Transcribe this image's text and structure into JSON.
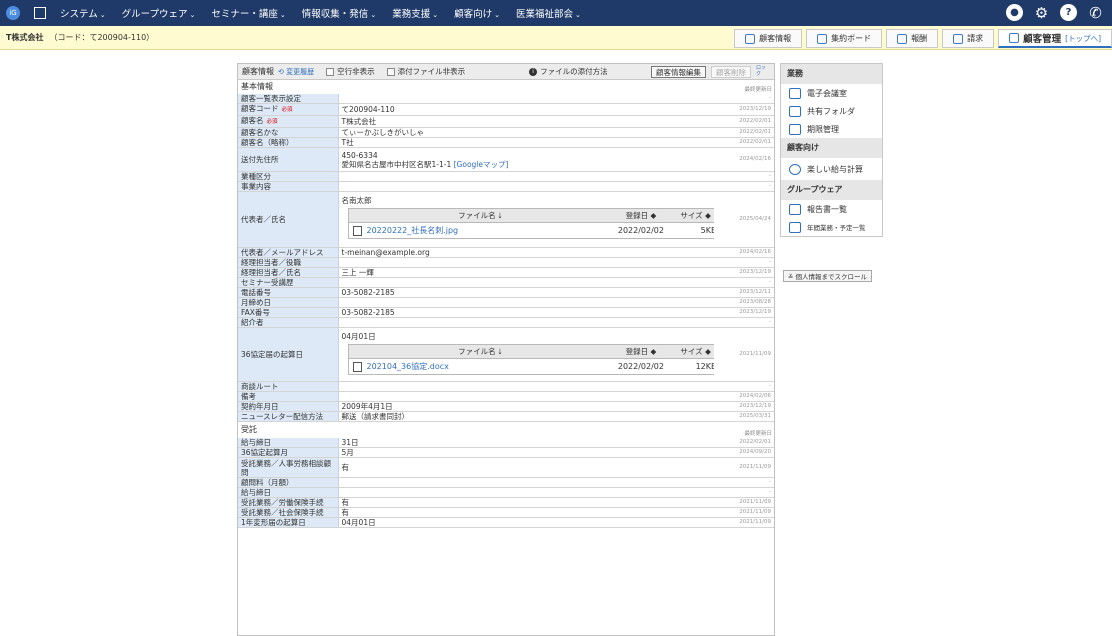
{
  "nav": {
    "items": [
      {
        "label": "システム"
      },
      {
        "label": "グループウェア"
      },
      {
        "label": "セミナー・講座"
      },
      {
        "label": "情報収集・発信"
      },
      {
        "label": "業務支援"
      },
      {
        "label": "顧客向け"
      },
      {
        "label": "医業福祉部会"
      }
    ]
  },
  "company": {
    "name": "T株式会社",
    "code": "（コード：て200904-110）"
  },
  "tabs": [
    {
      "label": "顧客情報"
    },
    {
      "label": "集約ボード"
    },
    {
      "label": "報酬"
    },
    {
      "label": "請求"
    },
    {
      "label": "顧客管理",
      "sub": "[トップへ]"
    }
  ],
  "toolbar": {
    "title": "顧客情報",
    "history": "⟲ 変更履歴",
    "hide_blank": "空行非表示",
    "hide_attach": "添付ファイル非表示",
    "attach_method": "ファイルの添付方法",
    "edit": "顧客情報編集",
    "delete": "顧客削除",
    "lock": "ロック"
  },
  "basic": {
    "title": "基本情報",
    "updated": "最終更新日",
    "rows": [
      {
        "label": "顧客一覧表示設定",
        "value": "",
        "date": "-"
      },
      {
        "label": "顧客コード",
        "req": "必須",
        "value": "て200904-110",
        "date": "2023/12/19"
      },
      {
        "label": "顧客名",
        "req": "必須",
        "value": "T株式会社",
        "date": "2022/02/01"
      },
      {
        "label": "顧客名かな",
        "value": "てぃーかぶしきがいしゃ",
        "date": "2022/02/01"
      },
      {
        "label": "顧客名（略称）",
        "value": "T社",
        "date": "2022/02/01"
      },
      {
        "label": "送付先住所",
        "value": "450-6334",
        "value2": "愛知県名古屋市中村区名駅1-1-1",
        "link": "[Googleマップ]",
        "date": "2024/02/16"
      },
      {
        "label": "業種区分",
        "value": "",
        "date": "-"
      },
      {
        "label": "事業内容",
        "value": "",
        "date": "-"
      },
      {
        "label": "代表者／氏名",
        "value": "名南太郎",
        "date": "2025/04/24"
      },
      {
        "label": "代表者／メールアドレス",
        "value": "t-meinan@example.org",
        "date": "2024/02/16"
      },
      {
        "label": "経理担当者／役職",
        "value": "",
        "date": "-"
      },
      {
        "label": "経理担当者／氏名",
        "value": "三上 一輝",
        "date": "2023/12/19"
      },
      {
        "label": "セミナー受講歴",
        "value": "",
        "date": "-"
      },
      {
        "label": "電話番号",
        "value": "03-5082-2185",
        "date": "2023/12/11"
      },
      {
        "label": "月締め日",
        "value": "",
        "date": "2023/08/28"
      },
      {
        "label": "FAX番号",
        "value": "03-5082-2185",
        "date": "2023/12/19"
      },
      {
        "label": "紹介者",
        "value": "",
        "date": "-"
      },
      {
        "label": "36協定届の起算日",
        "value": "04月01日",
        "date": "2021/11/09"
      },
      {
        "label": "商談ルート",
        "value": "",
        "date": "-"
      },
      {
        "label": "備考",
        "value": "",
        "date": "2024/02/06"
      },
      {
        "label": "契約年月日",
        "value": "2009年4月1日",
        "date": "2023/12/19"
      },
      {
        "label": "ニュースレター配信方法",
        "value": "郵送（請求書同封）",
        "date": "2025/03/31"
      }
    ],
    "file_header": {
      "name": "ファイル名 ⭣",
      "date": "登録日 ◆",
      "size": "サイズ ◆"
    },
    "file1": {
      "name": "20220222_社長名刺.jpg",
      "date": "2022/02/02",
      "size": "5KB"
    },
    "file2": {
      "name": "202104_36協定.docx",
      "date": "2022/02/02",
      "size": "12KB"
    }
  },
  "trust": {
    "title": "受託",
    "updated": "最終更新日",
    "rows": [
      {
        "label": "給与締日",
        "value": "31日",
        "date": "2022/02/01"
      },
      {
        "label": "36協定起算月",
        "value": "5月",
        "date": "2024/09/20"
      },
      {
        "label": "受託業務／人事労務相談顧問",
        "value": "有",
        "date": "2021/11/09"
      },
      {
        "label": "顧問料（月額）",
        "value": "",
        "date": "-"
      },
      {
        "label": "給与締日",
        "value": "",
        "date": "-"
      },
      {
        "label": "受託業務／労働保険手続",
        "value": "有",
        "date": "2021/11/09"
      },
      {
        "label": "受託業務／社会保険手続",
        "value": "有",
        "date": "2021/11/09"
      },
      {
        "label": "1年変形届の起算日",
        "value": "04月01日",
        "date": "2021/11/09"
      }
    ]
  },
  "side": {
    "sec1": "業務",
    "s1": "電子会議室",
    "s2": "共有フォルダ",
    "s3": "期限管理",
    "sec2": "顧客向け",
    "s4": "楽しい給与計算",
    "sec3": "グループウェア",
    "s5": "報告書一覧",
    "s6": "年間業務・予定一覧",
    "scroll": "≚ 個人情報までスクロール"
  }
}
